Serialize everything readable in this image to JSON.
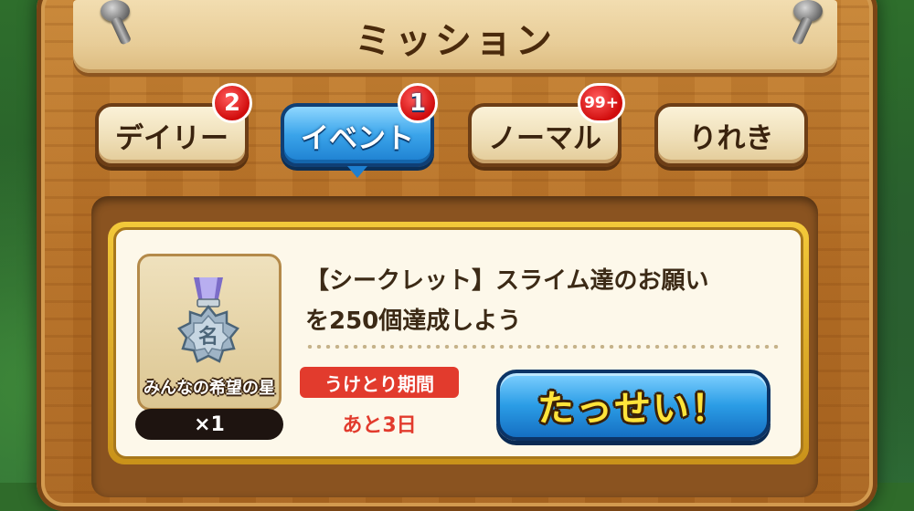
{
  "title": "ミッション",
  "tabs": [
    {
      "label": "デイリー",
      "badge": "2",
      "active": false
    },
    {
      "label": "イベント",
      "badge": "1",
      "active": true
    },
    {
      "label": "ノーマル",
      "badge": "99+",
      "active": false
    },
    {
      "label": "りれき",
      "badge": "",
      "active": false
    }
  ],
  "mission": {
    "text_line1": "【シークレット】スライム達のお願い",
    "text_line2": "を250個達成しよう",
    "reward": {
      "name": "みんなの希望の星",
      "quantity": "×1",
      "icon": "medal-icon",
      "medal_char": "名"
    },
    "period_label": "うけとり期間",
    "period_value": "あと3日",
    "achieve_label": "たっせい！"
  },
  "colors": {
    "active_tab": "#2b9de6",
    "badge": "#d00c0c",
    "period": "#e23b2d",
    "achieve_text": "#ffe43a"
  }
}
